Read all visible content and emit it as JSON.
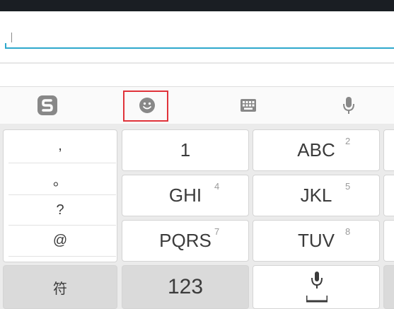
{
  "input": {
    "cursor": "|"
  },
  "toolbar": {
    "logo_icon": "sogou-logo-icon",
    "emoji_icon": "emoji-icon",
    "keyboard_icon": "keyboard-icon",
    "mic_icon": "microphone-icon",
    "highlight_color": "#e0333a"
  },
  "punctuation": [
    ",",
    "。",
    "?",
    "@"
  ],
  "keys": {
    "k1": {
      "label": "1"
    },
    "abc": {
      "label": "ABC",
      "num": "2"
    },
    "ghi": {
      "label": "GHI",
      "num": "4"
    },
    "jkl": {
      "label": "JKL",
      "num": "5"
    },
    "pqrs": {
      "label": "PQRS",
      "num": "7"
    },
    "tuv": {
      "label": "TUV",
      "num": "8"
    },
    "symbols": {
      "label": "符"
    },
    "numbers": {
      "label": "123"
    }
  },
  "colors": {
    "accent": "#2ea8cc",
    "background": "#ebebeb"
  }
}
